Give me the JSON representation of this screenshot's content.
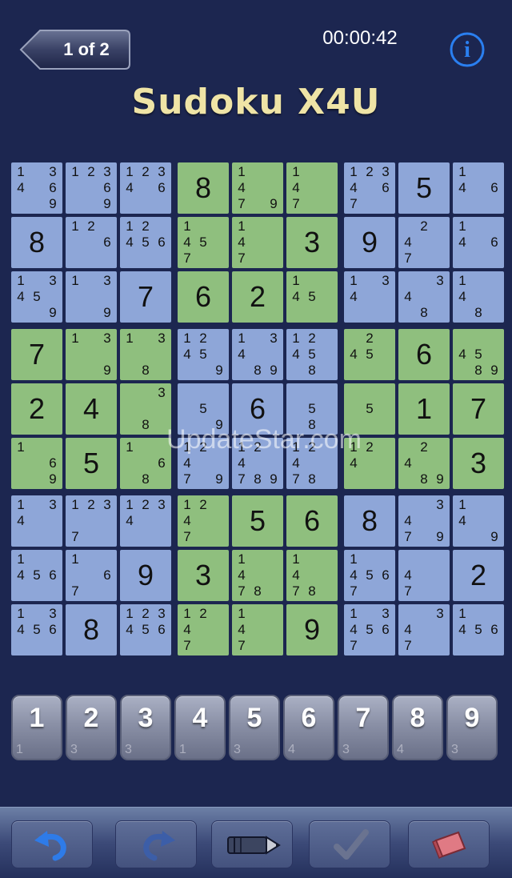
{
  "header": {
    "back_label": "1 of 2",
    "timer": "00:00:42",
    "title": "Sudoku X4U",
    "info_icon": "info-icon",
    "title_color": "#efe4a6"
  },
  "colors": {
    "background": "#1c2650",
    "blue_cell": "#8ea6d8",
    "green_cell": "#8fbf7e"
  },
  "board": {
    "box_colors": [
      [
        "blue",
        "green",
        "blue"
      ],
      [
        "green",
        "blue",
        "green"
      ],
      [
        "blue",
        "green",
        "blue"
      ]
    ],
    "cells": [
      [
        {
          "v": "",
          "pm": [
            1,
            3,
            4,
            6,
            9
          ]
        },
        {
          "v": "",
          "pm": [
            1,
            2,
            3,
            6,
            9
          ]
        },
        {
          "v": "",
          "pm": [
            1,
            2,
            3,
            4,
            6
          ]
        },
        {
          "v": "8"
        },
        {
          "v": "",
          "pm": [
            1,
            4,
            7,
            9
          ]
        },
        {
          "v": "",
          "pm": [
            1,
            4,
            7
          ]
        },
        {
          "v": "",
          "pm": [
            1,
            2,
            3,
            4,
            6,
            7
          ]
        },
        {
          "v": "5"
        },
        {
          "v": "",
          "pm": [
            1,
            4,
            6
          ]
        }
      ],
      [
        {
          "v": "8"
        },
        {
          "v": "",
          "pm": [
            1,
            2,
            6
          ]
        },
        {
          "v": "",
          "pm": [
            1,
            2,
            4,
            5,
            6
          ]
        },
        {
          "v": "",
          "pm": [
            1,
            4,
            5,
            7
          ]
        },
        {
          "v": "",
          "pm": [
            1,
            4,
            7
          ]
        },
        {
          "v": "3"
        },
        {
          "v": "9"
        },
        {
          "v": "",
          "pm": [
            2,
            4,
            7
          ]
        },
        {
          "v": "",
          "pm": [
            1,
            4,
            6
          ]
        }
      ],
      [
        {
          "v": "",
          "pm": [
            1,
            3,
            4,
            5,
            9
          ]
        },
        {
          "v": "",
          "pm": [
            1,
            3,
            9
          ]
        },
        {
          "v": "7"
        },
        {
          "v": "6"
        },
        {
          "v": "2"
        },
        {
          "v": "",
          "pm": [
            1,
            4,
            5
          ]
        },
        {
          "v": "",
          "pm": [
            1,
            3,
            4
          ]
        },
        {
          "v": "",
          "pm": [
            3,
            4,
            8
          ]
        },
        {
          "v": "",
          "pm": [
            1,
            4,
            8
          ]
        }
      ],
      [
        {
          "v": "7"
        },
        {
          "v": "",
          "pm": [
            1,
            3,
            9
          ]
        },
        {
          "v": "",
          "pm": [
            1,
            3,
            8
          ]
        },
        {
          "v": "",
          "pm": [
            1,
            2,
            4,
            5,
            9
          ]
        },
        {
          "v": "",
          "pm": [
            1,
            3,
            4,
            8,
            9
          ]
        },
        {
          "v": "",
          "pm": [
            1,
            2,
            4,
            5,
            8
          ]
        },
        {
          "v": "",
          "pm": [
            2,
            4,
            5
          ]
        },
        {
          "v": "6"
        },
        {
          "v": "",
          "pm": [
            4,
            5,
            8,
            9
          ]
        }
      ],
      [
        {
          "v": "2"
        },
        {
          "v": "4"
        },
        {
          "v": "",
          "pm": [
            3,
            8
          ]
        },
        {
          "v": "",
          "pm": [
            5,
            9
          ]
        },
        {
          "v": "6"
        },
        {
          "v": "",
          "pm": [
            5,
            8
          ]
        },
        {
          "v": "",
          "pm": [
            5
          ]
        },
        {
          "v": "1"
        },
        {
          "v": "7"
        }
      ],
      [
        {
          "v": "",
          "pm": [
            1,
            6,
            9
          ]
        },
        {
          "v": "5"
        },
        {
          "v": "",
          "pm": [
            1,
            6,
            8
          ]
        },
        {
          "v": "",
          "pm": [
            1,
            2,
            4,
            7,
            9
          ]
        },
        {
          "v": "",
          "pm": [
            1,
            2,
            4,
            7,
            8,
            9
          ]
        },
        {
          "v": "",
          "pm": [
            1,
            2,
            4,
            7,
            8
          ]
        },
        {
          "v": "",
          "pm": [
            1,
            2,
            4
          ]
        },
        {
          "v": "",
          "pm": [
            2,
            4,
            8,
            9
          ]
        },
        {
          "v": "3"
        }
      ],
      [
        {
          "v": "",
          "pm": [
            1,
            3,
            4
          ]
        },
        {
          "v": "",
          "pm": [
            1,
            2,
            3,
            7
          ]
        },
        {
          "v": "",
          "pm": [
            1,
            2,
            3,
            4
          ]
        },
        {
          "v": "",
          "pm": [
            1,
            2,
            4,
            7
          ]
        },
        {
          "v": "5"
        },
        {
          "v": "6"
        },
        {
          "v": "8"
        },
        {
          "v": "",
          "pm": [
            3,
            4,
            7,
            9
          ]
        },
        {
          "v": "",
          "pm": [
            1,
            4,
            9
          ]
        }
      ],
      [
        {
          "v": "",
          "pm": [
            1,
            4,
            5,
            6
          ]
        },
        {
          "v": "",
          "pm": [
            1,
            6,
            7
          ]
        },
        {
          "v": "9"
        },
        {
          "v": "3"
        },
        {
          "v": "",
          "pm": [
            1,
            4,
            7,
            8
          ]
        },
        {
          "v": "",
          "pm": [
            1,
            4,
            7,
            8
          ]
        },
        {
          "v": "",
          "pm": [
            1,
            4,
            5,
            6,
            7
          ]
        },
        {
          "v": "",
          "pm": [
            4,
            7
          ]
        },
        {
          "v": "2"
        }
      ],
      [
        {
          "v": "",
          "pm": [
            1,
            3,
            4,
            5,
            6
          ]
        },
        {
          "v": "8"
        },
        {
          "v": "",
          "pm": [
            1,
            2,
            3,
            4,
            5,
            6
          ]
        },
        {
          "v": "",
          "pm": [
            1,
            2,
            4,
            7
          ]
        },
        {
          "v": "",
          "pm": [
            1,
            4,
            7
          ]
        },
        {
          "v": "9"
        },
        {
          "v": "",
          "pm": [
            1,
            3,
            4,
            5,
            6,
            7
          ]
        },
        {
          "v": "",
          "pm": [
            3,
            4,
            7
          ]
        },
        {
          "v": "",
          "pm": [
            1,
            4,
            5,
            6
          ]
        }
      ]
    ]
  },
  "watermark": "UpdateStar.com",
  "keypad": [
    {
      "label": "1",
      "count": "1"
    },
    {
      "label": "2",
      "count": "3"
    },
    {
      "label": "3",
      "count": "3"
    },
    {
      "label": "4",
      "count": "1"
    },
    {
      "label": "5",
      "count": "3"
    },
    {
      "label": "6",
      "count": "4"
    },
    {
      "label": "7",
      "count": "3"
    },
    {
      "label": "8",
      "count": "4"
    },
    {
      "label": "9",
      "count": "3"
    }
  ],
  "toolbar": {
    "buttons": [
      {
        "name": "undo-button",
        "icon": "undo-arrow-icon",
        "enabled": true
      },
      {
        "name": "redo-button",
        "icon": "redo-arrow-icon",
        "enabled": false
      },
      {
        "name": "pencil-button",
        "icon": "pencil-icon",
        "enabled": true
      },
      {
        "name": "check-button",
        "icon": "checkmark-icon",
        "enabled": false
      },
      {
        "name": "eraser-button",
        "icon": "eraser-icon",
        "enabled": true
      }
    ]
  }
}
